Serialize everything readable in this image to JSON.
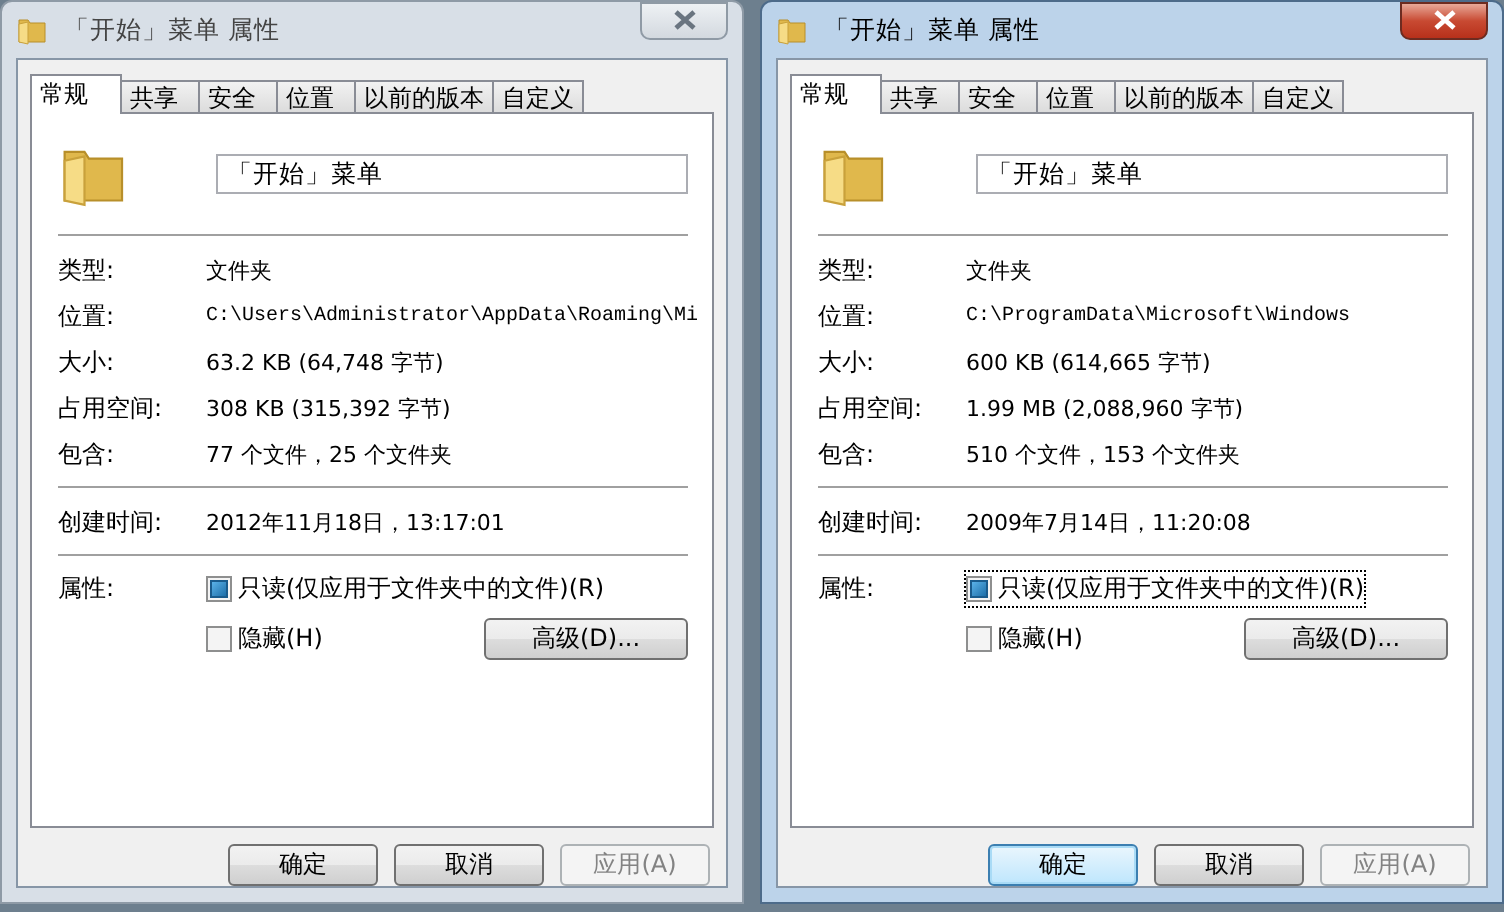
{
  "windows": [
    {
      "title": "「开始」菜单 属性",
      "active": false,
      "tabs": [
        {
          "label": "常规",
          "selected": true
        },
        {
          "label": "共享",
          "selected": false
        },
        {
          "label": "安全",
          "selected": false
        },
        {
          "label": "位置",
          "selected": false
        },
        {
          "label": "以前的版本",
          "selected": false
        },
        {
          "label": "自定义",
          "selected": false
        }
      ],
      "name_field": {
        "value": "「开始」菜单"
      },
      "details": [
        {
          "label": "类型:",
          "value": "文件夹",
          "kind": "text"
        },
        {
          "label": "位置:",
          "value": "C:\\Users\\Administrator\\AppData\\Roaming\\Mi",
          "kind": "path"
        },
        {
          "label": "大小:",
          "value": "63.2 KB (64,748 字节)",
          "kind": "text"
        },
        {
          "label": "占用空间:",
          "value": "308 KB (315,392 字节)",
          "kind": "text"
        },
        {
          "label": "包含:",
          "value": "77 个文件，25 个文件夹",
          "kind": "text"
        }
      ],
      "dates": [
        {
          "label": "创建时间:",
          "value": "2012年11月18日，13:17:01"
        }
      ],
      "attributes": {
        "label": "属性:",
        "options": [
          {
            "label": "只读(仅应用于文件夹中的文件)(R)",
            "checked": true,
            "focused": false
          },
          {
            "label": "隐藏(H)",
            "checked": false,
            "focused": false
          }
        ],
        "advanced_button": "高级(D)..."
      },
      "buttons": [
        {
          "label": "确定",
          "default": false,
          "disabled": false
        },
        {
          "label": "取消",
          "default": false,
          "disabled": false
        },
        {
          "label": "应用(A)",
          "default": false,
          "disabled": true
        }
      ]
    },
    {
      "title": "「开始」菜单 属性",
      "active": true,
      "tabs": [
        {
          "label": "常规",
          "selected": true
        },
        {
          "label": "共享",
          "selected": false
        },
        {
          "label": "安全",
          "selected": false
        },
        {
          "label": "位置",
          "selected": false
        },
        {
          "label": "以前的版本",
          "selected": false
        },
        {
          "label": "自定义",
          "selected": false
        }
      ],
      "name_field": {
        "value": "「开始」菜单"
      },
      "details": [
        {
          "label": "类型:",
          "value": "文件夹",
          "kind": "text"
        },
        {
          "label": "位置:",
          "value": "C:\\ProgramData\\Microsoft\\Windows",
          "kind": "path"
        },
        {
          "label": "大小:",
          "value": "600 KB (614,665 字节)",
          "kind": "text"
        },
        {
          "label": "占用空间:",
          "value": "1.99 MB (2,088,960 字节)",
          "kind": "text"
        },
        {
          "label": "包含:",
          "value": "510 个文件，153 个文件夹",
          "kind": "text"
        }
      ],
      "dates": [
        {
          "label": "创建时间:",
          "value": "2009年7月14日，11:20:08"
        }
      ],
      "attributes": {
        "label": "属性:",
        "options": [
          {
            "label": "只读(仅应用于文件夹中的文件)(R)",
            "checked": true,
            "focused": true
          },
          {
            "label": "隐藏(H)",
            "checked": false,
            "focused": false
          }
        ],
        "advanced_button": "高级(D)..."
      },
      "buttons": [
        {
          "label": "确定",
          "default": true,
          "disabled": false
        },
        {
          "label": "取消",
          "default": false,
          "disabled": false
        },
        {
          "label": "应用(A)",
          "default": false,
          "disabled": true
        }
      ]
    }
  ]
}
